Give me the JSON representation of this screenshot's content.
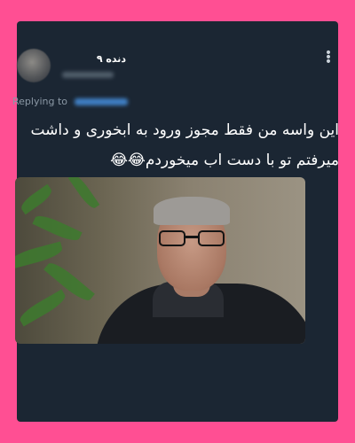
{
  "tweet": {
    "display_name": "دنده ۹",
    "replying_to_label": "Replying to",
    "text_line1": "این واسه من فقط مجوز ورود به ابخوری و داشت",
    "text_line2": "میرفتم تو با دست اب میخوردم😂😂"
  },
  "icons": {
    "more": "more-vertical-icon"
  },
  "colors": {
    "frame": "#ff4f93",
    "card": "#1b2633",
    "text": "#ffffff",
    "muted": "#8b98a5",
    "link": "#3f7fc4"
  }
}
